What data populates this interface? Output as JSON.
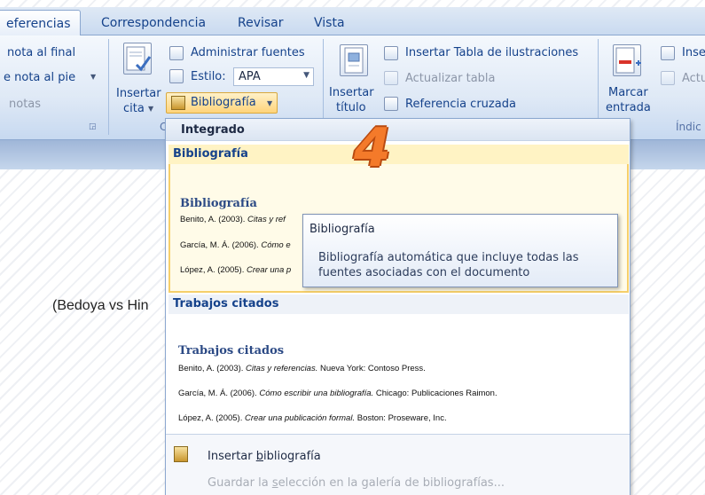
{
  "tabs": {
    "referencias": "eferencias",
    "correspondencia": "Correspondencia",
    "revisar": "Revisar",
    "vista": "Vista"
  },
  "ribbon": {
    "footnotes": {
      "nota_al_final": "nota al final",
      "nota_al_pie": "e nota al pie",
      "notas": "notas"
    },
    "citations": {
      "insertar_cita_line1": "Insertar",
      "insertar_cita_line2": "cita",
      "administrar_fuentes": "Administrar fuentes",
      "estilo_label": "Estilo:",
      "estilo_value": "APA",
      "bibliografia_button": "Bibliografía",
      "group_label_partial": "C"
    },
    "captions": {
      "insertar_titulo_line1": "Insertar",
      "insertar_titulo_line2": "título",
      "insertar_tabla_ilustraciones": "Insertar Tabla de ilustraciones",
      "actualizar_tabla": "Actualizar tabla",
      "referencia_cruzada": "Referencia cruzada"
    },
    "index": {
      "marcar_entrada_line1": "Marcar",
      "marcar_entrada_line2": "entrada",
      "inse": "Inse",
      "actu": "Actu",
      "group_label_partial": "Índic"
    }
  },
  "document": {
    "visible_text": "(Bedoya vs Hin"
  },
  "dropdown": {
    "header": "Integrado",
    "sections": [
      {
        "head": "Bibliografía",
        "card_title": "Bibliografía",
        "entries": [
          {
            "plain": "Benito, A. (2003). ",
            "italic": "Citas y ref",
            "rest": ""
          },
          {
            "plain": "García, M. Á. (2006). ",
            "italic": "Cómo e",
            "rest": ""
          },
          {
            "plain": "López, A. (2005). ",
            "italic": "Crear una p",
            "rest": ""
          }
        ]
      },
      {
        "head": "Trabajos citados",
        "card_title": "Trabajos citados",
        "entries": [
          {
            "plain": "Benito, A. (2003). ",
            "italic": "Citas y referencias.",
            "rest": " Nueva York: Contoso Press."
          },
          {
            "plain": "García, M. Á. (2006). ",
            "italic": "Cómo escribir una bibliografía.",
            "rest": " Chicago: Publicaciones Raimon."
          },
          {
            "plain": "López, A. (2005). ",
            "italic": "Crear una publicación formal.",
            "rest": " Boston: Proseware, Inc."
          }
        ]
      }
    ],
    "insertar_bibliografia": {
      "before": "Insertar ",
      "underlined": "b",
      "after": "ibliografía"
    },
    "guardar_seleccion": {
      "before": "Guardar la ",
      "underlined": "s",
      "after": "elección en la galería de bibliografías..."
    }
  },
  "tooltip": {
    "title": "Bibliografía",
    "body": "Bibliografía automática que incluye todas las fuentes asociadas con el documento"
  },
  "step_badge": "4",
  "colors": {
    "badge_orange": "#f47a2a",
    "ribbon_blue": "#15428b",
    "highlight_yellow": "#f5cf6a"
  }
}
